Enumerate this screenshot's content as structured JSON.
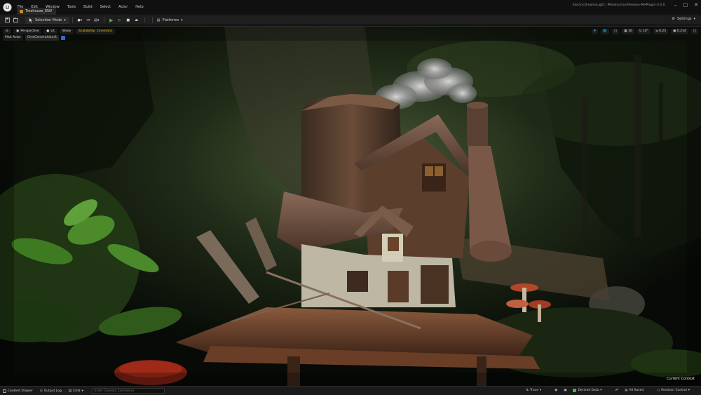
{
  "menu": {
    "items": [
      "File",
      "Edit",
      "Window",
      "Tools",
      "Build",
      "Select",
      "Actor",
      "Help"
    ]
  },
  "window": {
    "project_path": "ElectricDreamsLight | Metahuman/Release-MHPlugin-3.0.0"
  },
  "tab": {
    "level_name": "Treehouse_ENV"
  },
  "toolbar": {
    "mode_label": "Selection Mode",
    "platforms_label": "Platforms",
    "settings_label": "Settings"
  },
  "viewport": {
    "perspective_label": "Perspective",
    "lit_label": "Lit",
    "show_label": "Show",
    "scalability_label": "Scalability: Cinematic",
    "pilot_label": "Pilot Actor",
    "pilot_camera": "CineCameraActor1",
    "grid_snap_value": "10",
    "rotation_snap_value": "10°",
    "scale_snap_value": "0.25",
    "camera_speed_value": "0.214",
    "current_context": "Current Context"
  },
  "statusbar": {
    "content_drawer": "Content Drawer",
    "output_log": "Output Log",
    "cmd_label": "Cmd",
    "cmd_placeholder": "Enter Console Command",
    "trace_label": "Trace",
    "derived_data_label": "Derived Data",
    "all_saved_label": "All Saved",
    "revision_control_label": "Revision Control"
  },
  "colors": {
    "accent_blue": "#2a6fd6",
    "play_green": "#4caf50",
    "scalability_yellow": "#f0c030"
  }
}
